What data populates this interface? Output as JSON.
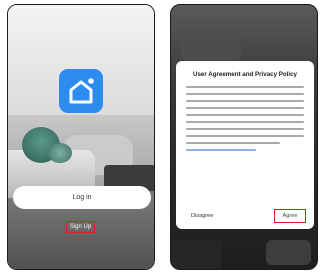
{
  "left_screen": {
    "login_label": "Log in",
    "signup_label": "Sign Up"
  },
  "right_screen": {
    "dialog_title": "User Agreement and Privacy Policy",
    "disagree_label": "Disagree",
    "agree_label": "Agree"
  },
  "colors": {
    "app_icon": "#2d8cf0",
    "highlight_box": "#e02020"
  },
  "icons": {
    "app_logo": "home-icon"
  }
}
